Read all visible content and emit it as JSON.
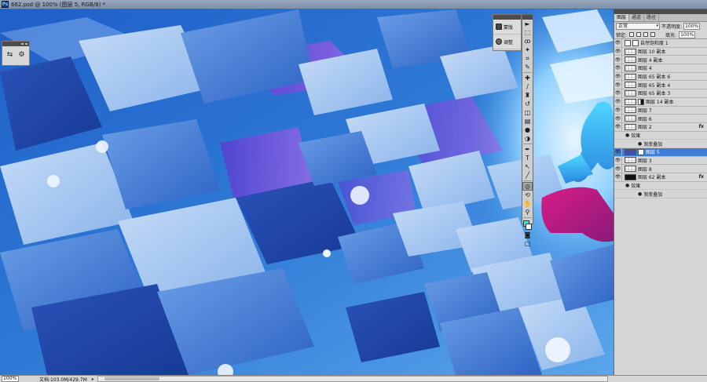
{
  "window": {
    "app_icon": "Ps",
    "title": "662.psd @ 100% (图层 5, RGB/8) *"
  },
  "canvas": {
    "description_colors": {
      "primary": "#2a6cd0",
      "light": "#b9d4f7",
      "violet": "#7b4bd8",
      "magenta": "#c0127a",
      "cyan": "#4fd0ff"
    }
  },
  "tool_options_palette": {
    "icons": [
      "options-icon",
      "sliders-icon"
    ]
  },
  "adjust_panel": {
    "items": [
      {
        "label": "蒙版",
        "icon": "mask-icon"
      },
      {
        "label": "调整",
        "icon": "adjust-icon"
      }
    ]
  },
  "toolbox": {
    "tools": [
      {
        "glyph": "►",
        "name": "move-tool-icon"
      },
      {
        "glyph": "⬚",
        "name": "marquee-tool-icon"
      },
      {
        "glyph": "ꝏ",
        "name": "lasso-tool-icon"
      },
      {
        "glyph": "✦",
        "name": "quick-select-tool-icon"
      },
      {
        "glyph": "⌗",
        "name": "crop-tool-icon"
      },
      {
        "glyph": "✎",
        "name": "eyedropper-tool-icon"
      },
      {
        "glyph": "✚",
        "name": "healing-brush-tool-icon"
      },
      {
        "glyph": "∕",
        "name": "brush-tool-icon"
      },
      {
        "glyph": "♜",
        "name": "stamp-tool-icon"
      },
      {
        "glyph": "↺",
        "name": "history-brush-tool-icon"
      },
      {
        "glyph": "◫",
        "name": "eraser-tool-icon"
      },
      {
        "glyph": "▤",
        "name": "gradient-tool-icon"
      },
      {
        "glyph": "●",
        "name": "blur-tool-icon"
      },
      {
        "glyph": "◑",
        "name": "dodge-tool-icon"
      },
      {
        "glyph": "✒",
        "name": "pen-tool-icon"
      },
      {
        "glyph": "T",
        "name": "type-tool-icon"
      },
      {
        "glyph": "↖",
        "name": "path-select-tool-icon"
      },
      {
        "glyph": "╱",
        "name": "shape-tool-icon"
      },
      {
        "glyph": "◎",
        "name": "3d-rotate-tool-icon"
      },
      {
        "glyph": "⟲",
        "name": "3d-orbit-tool-icon"
      },
      {
        "glyph": "✋",
        "name": "hand-tool-icon"
      },
      {
        "glyph": "⚲",
        "name": "zoom-tool-icon"
      }
    ],
    "foreground_color": "#40e5e9",
    "background_color": "#ffffff",
    "bottom_glyphs": [
      "◙",
      "▢"
    ]
  },
  "layers_panel": {
    "tabs": [
      "图层",
      "通道",
      "路径"
    ],
    "blend_mode": "正常",
    "opacity_label": "不透明度:",
    "opacity_value": "100%",
    "lock_label": "锁定:",
    "fill_label": "填充:",
    "fill_value": "100%",
    "layers": [
      {
        "name": "自然饱和度 1",
        "kind": "adjust",
        "selected": false,
        "fx": false
      },
      {
        "name": "图层 10 副本",
        "kind": "normal",
        "selected": false,
        "fx": false
      },
      {
        "name": "图层 4 副本",
        "kind": "normal",
        "selected": false,
        "fx": false
      },
      {
        "name": "图层 4",
        "kind": "normal",
        "selected": false,
        "fx": false
      },
      {
        "name": "图层 65 副本 6",
        "kind": "normal",
        "selected": false,
        "fx": false
      },
      {
        "name": "图层 65 副本 4",
        "kind": "normal",
        "selected": false,
        "fx": false
      },
      {
        "name": "图层 65 副本 3",
        "kind": "normal",
        "selected": false,
        "fx": false
      },
      {
        "name": "图层 14 副本",
        "kind": "mask",
        "selected": false,
        "fx": false
      },
      {
        "name": "图层 7",
        "kind": "normal",
        "selected": false,
        "fx": false
      },
      {
        "name": "图层 6",
        "kind": "normal",
        "selected": false,
        "fx": false
      },
      {
        "name": "图层 2",
        "kind": "normal",
        "selected": false,
        "fx": true
      },
      {
        "name": "效果",
        "kind": "effects-header"
      },
      {
        "name": "渐变叠加",
        "kind": "effect"
      },
      {
        "name": "图层 5",
        "kind": "blue-mask",
        "selected": true,
        "fx": false
      },
      {
        "name": "图层 3",
        "kind": "normal",
        "selected": false,
        "fx": false
      },
      {
        "name": "图层 8",
        "kind": "normal",
        "selected": false,
        "fx": false
      },
      {
        "name": "图层 62 副本",
        "kind": "black",
        "selected": false,
        "fx": true
      },
      {
        "name": "效果",
        "kind": "effects-header"
      },
      {
        "name": "渐变叠加",
        "kind": "effect"
      }
    ],
    "fx_label": "fx"
  },
  "status": {
    "zoom": "100%",
    "doc_size": "文档:103.0M/429.7M",
    "arrow": "▸"
  }
}
